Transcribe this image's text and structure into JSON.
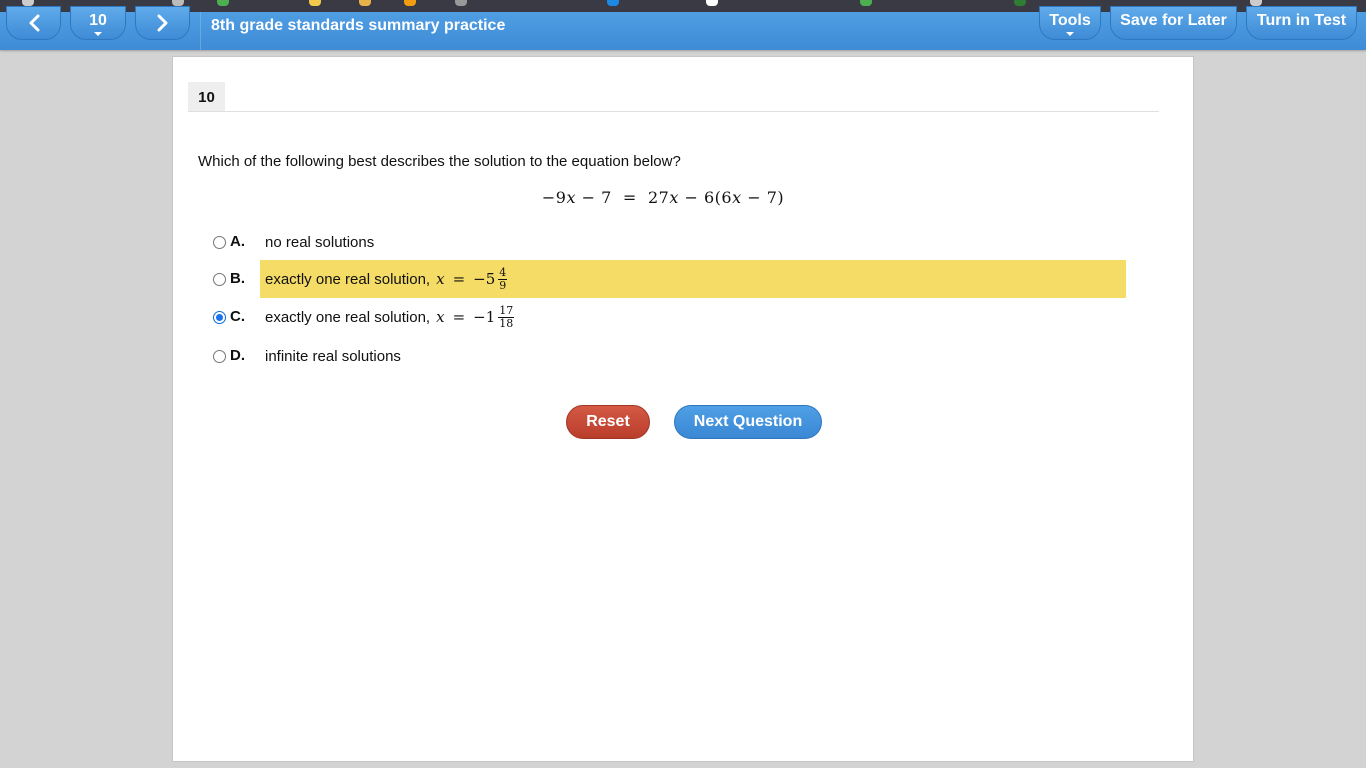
{
  "browser": {
    "bookmark_colors": [
      "#cccccc",
      "#4caf50",
      "#f2c94c",
      "#e8b24a",
      "#f39c12",
      "#bbbbbb",
      "#1e88e5",
      "#ffffff",
      "#4caf50",
      "#2e7d32",
      "#cccccc"
    ]
  },
  "toolbar": {
    "prev_icon": "chevron-left-icon",
    "question_number": "10",
    "next_icon": "chevron-right-icon",
    "test_title": "8th grade standards summary practice",
    "tools_label": "Tools",
    "save_label": "Save for Later",
    "turn_in_label": "Turn in Test"
  },
  "question": {
    "number": "10",
    "prompt": "Which of the following best describes the solution to the equation below?",
    "equation": {
      "lhs_coef": "−9",
      "var": "x",
      "lhs_const": "− 7",
      "equals": "=",
      "rhs_coef": "27",
      "rhs_rest_a": "− 6(6",
      "rhs_rest_b": "− 7)"
    }
  },
  "options": [
    {
      "letter": "A.",
      "text": "no real solutions",
      "selected": false,
      "highlighted": false
    },
    {
      "letter": "B.",
      "text": "exactly one real solution,",
      "math": {
        "var": "x",
        "eq": "=",
        "whole": "−5",
        "num": "4",
        "den": "9"
      },
      "selected": false,
      "highlighted": true
    },
    {
      "letter": "C.",
      "text": "exactly one real solution,",
      "math": {
        "var": "x",
        "eq": "=",
        "whole": "−1",
        "num": "17",
        "den": "18"
      },
      "selected": true,
      "highlighted": false
    },
    {
      "letter": "D.",
      "text": "infinite real solutions",
      "selected": false,
      "highlighted": false
    }
  ],
  "actions": {
    "reset_label": "Reset",
    "next_label": "Next Question"
  },
  "colors": {
    "toolbar_blue": "#3f8bd6",
    "highlight_yellow": "#f5dc66",
    "reset_red": "#c0442f",
    "next_blue": "#3a87d4"
  }
}
